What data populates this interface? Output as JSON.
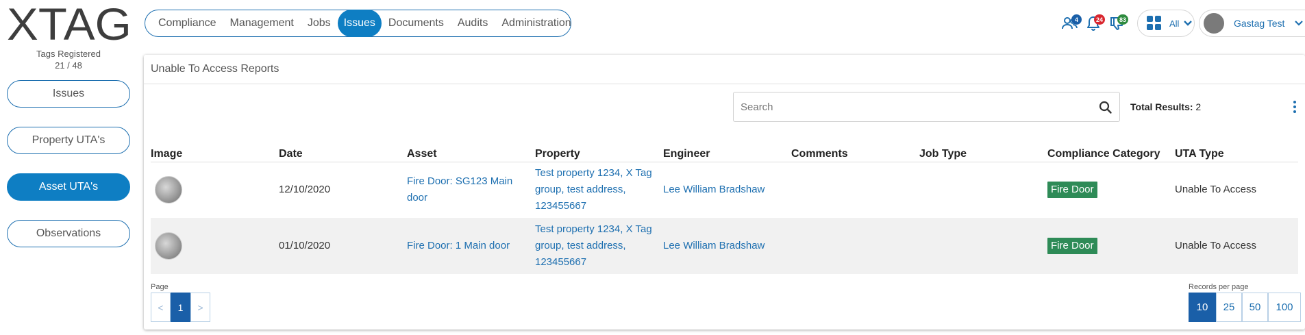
{
  "brand": {
    "logo_text": "XTAG",
    "accent": "#0e7ec3"
  },
  "tags": {
    "label": "Tags Registered",
    "count": "21 / 48"
  },
  "sidebar": {
    "items": [
      {
        "label": "Issues",
        "active": false
      },
      {
        "label": "Property UTA's",
        "active": false
      },
      {
        "label": "Asset UTA's",
        "active": true
      },
      {
        "label": "Observations",
        "active": false
      }
    ]
  },
  "nav": {
    "items": [
      {
        "label": "Compliance"
      },
      {
        "label": "Management"
      },
      {
        "label": "Jobs"
      },
      {
        "label": "Issues",
        "active": true
      },
      {
        "label": "Documents"
      },
      {
        "label": "Audits"
      },
      {
        "label": "Administration"
      }
    ]
  },
  "header": {
    "users_badge": "4",
    "notifications_badge": "24",
    "feedback_badge": "83",
    "apps_label": "All",
    "user_name": "Gastag Test"
  },
  "panel": {
    "title": "Unable To Access Reports",
    "search_placeholder": "Search",
    "total_label": "Total Results:",
    "total_value": "2"
  },
  "table": {
    "columns": [
      "Image",
      "Date",
      "Asset",
      "Property",
      "Engineer",
      "Comments",
      "Job Type",
      "Compliance Category",
      "UTA Type"
    ],
    "rows": [
      {
        "date": "12/10/2020",
        "asset": "Fire Door: SG123 Main door",
        "property": "Test property 1234, X Tag group, test address, 123455667",
        "engineer": "Lee William Bradshaw",
        "comments": "",
        "job_type": "",
        "category": "Fire Door",
        "uta_type": "Unable To Access"
      },
      {
        "date": "01/10/2020",
        "asset": "Fire Door: 1 Main door",
        "property": "Test property 1234, X Tag group, test address, 123455667",
        "engineer": "Lee William Bradshaw",
        "comments": "",
        "job_type": "",
        "category": "Fire Door",
        "uta_type": "Unable To Access"
      }
    ]
  },
  "pagination": {
    "page_label": "Page",
    "prev": "<",
    "current": "1",
    "next": ">",
    "records_label": "Records per page",
    "records_options": [
      "10",
      "25",
      "50",
      "100"
    ],
    "records_selected": "10"
  }
}
